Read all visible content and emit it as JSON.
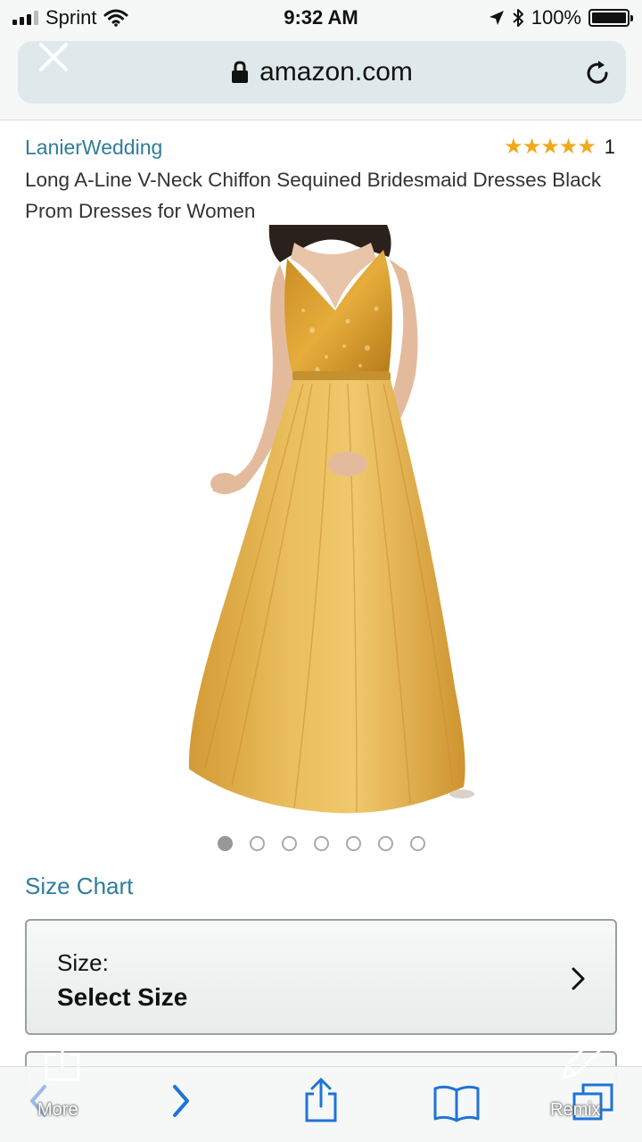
{
  "status_bar": {
    "carrier": "Sprint",
    "time": "9:32 AM",
    "battery_percent": "100%",
    "battery_level": 1.0
  },
  "browser": {
    "domain": "amazon.com",
    "icons": {
      "close": "close-icon",
      "lock": "lock-icon",
      "reload": "reload-icon"
    }
  },
  "product": {
    "brand": "LanierWedding",
    "rating_stars": "★★★★★",
    "rating_value": 5,
    "rating_count": "1",
    "title": "Long A-Line V-Neck Chiffon Sequined Bridesmaid Dresses Black Prom Dresses for Women",
    "image": {
      "description_icon": "gold-dress-image",
      "dress_color": "#e4b24a"
    },
    "carousel": {
      "total": 7,
      "active_index": 0
    }
  },
  "size": {
    "chart_link": "Size Chart",
    "label": "Size:",
    "value": "Select Size"
  },
  "overlay": {
    "more_label": "More",
    "remix_label": "Remix"
  },
  "colors": {
    "link": "#2f7d9c",
    "star": "#f0a91b",
    "ios_blue": "#1f74d6"
  }
}
